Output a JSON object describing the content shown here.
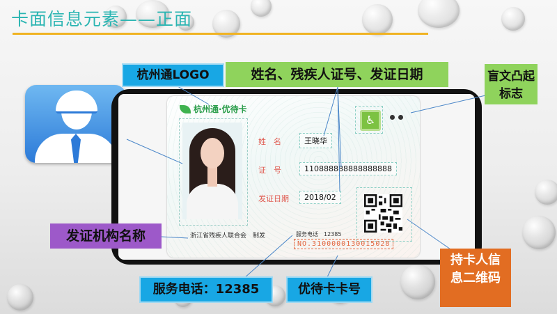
{
  "slide": {
    "title": "卡面信息元素——正面"
  },
  "callouts": {
    "logo": "杭州通LOGO",
    "name_fields": "姓名、残疾人证号、发证日期",
    "braille": "盲文凸起标志",
    "issuer": "发证机构名称",
    "service": "服务电话：12385",
    "card_no": "优待卡卡号",
    "qr": "持卡人信息二维码"
  },
  "card": {
    "brand": "杭州通·优待卡",
    "name_label": "姓　名",
    "name_value": "王晓华",
    "id_label": "证　号",
    "id_value": "110888888888888888",
    "date_label": "发证日期",
    "date_value": "2018/02",
    "issuer": "浙江省残疾人联合会　制发",
    "service": "服务电话　12385",
    "number": "NO.3100000130015028"
  },
  "icons": {
    "avatar": "user-avatar-icon",
    "wheelchair": "wheelchair-icon",
    "qr": "qr-code-icon"
  },
  "colors": {
    "title": "#2bb5b2",
    "rule": "#f0b323",
    "blue": "#18a7e4",
    "green": "#8fd35c",
    "purple": "#9d59c9",
    "orange": "#e26d22"
  }
}
